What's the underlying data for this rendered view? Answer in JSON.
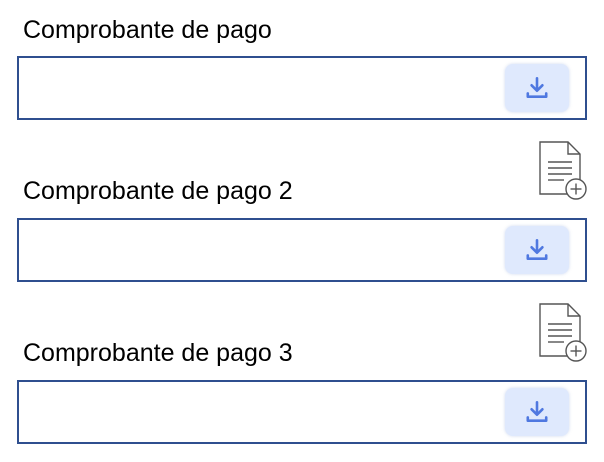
{
  "fields": [
    {
      "label": "Comprobante de pago"
    },
    {
      "label": "Comprobante de pago 2"
    },
    {
      "label": "Comprobante de pago 3"
    }
  ],
  "icons": {
    "upload_button": "download-icon",
    "add_file": "file-add-icon"
  },
  "colors": {
    "field_border": "#2f4f8f",
    "button_bg": "#dfe9fd",
    "button_icon": "#4f78e0",
    "file_icon_stroke": "#555555"
  }
}
